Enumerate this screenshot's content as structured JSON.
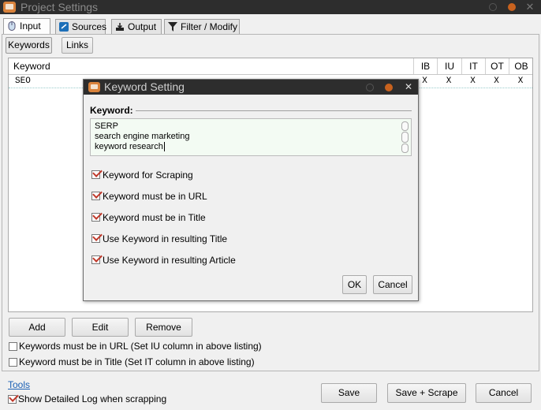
{
  "window": {
    "title": "Project Settings"
  },
  "tabs": [
    {
      "label": "Input"
    },
    {
      "label": "Sources"
    },
    {
      "label": "Output"
    },
    {
      "label": "Filter / Modify"
    }
  ],
  "subtabs": [
    {
      "label": "Keywords"
    },
    {
      "label": "Links"
    }
  ],
  "table": {
    "columns": [
      "Keyword",
      "IB",
      "IU",
      "IT",
      "OT",
      "OB"
    ],
    "rows": [
      {
        "keyword": "SEO",
        "ib": "X",
        "iu": "X",
        "it": "X",
        "ot": "X",
        "ob": "X"
      }
    ]
  },
  "actions": {
    "add": "Add",
    "edit": "Edit",
    "remove": "Remove"
  },
  "options": {
    "in_url": {
      "label": "Keywords must be in URL (Set IU column in above listing)",
      "checked": false
    },
    "in_title": {
      "label": "Keyword must be in Title (Set IT column in above listing)",
      "checked": false
    }
  },
  "footer": {
    "tools_link": "Tools",
    "log_option": {
      "label": "Show Detailed Log when scrapping",
      "checked": true
    },
    "save": "Save",
    "save_scrape": "Save + Scrape",
    "cancel": "Cancel"
  },
  "dialog": {
    "title": "Keyword Setting",
    "keyword_label": "Keyword:",
    "keywords": [
      "SERP",
      "search engine marketing",
      "keyword research"
    ],
    "checkboxes": [
      {
        "label": "Keyword for Scraping",
        "checked": true
      },
      {
        "label": "Keyword must be in URL",
        "checked": true
      },
      {
        "label": "Keyword must be in Title",
        "checked": true
      },
      {
        "label": "Use Keyword in resulting Title",
        "checked": true
      },
      {
        "label": "Use Keyword in resulting Article",
        "checked": true
      }
    ],
    "ok": "OK",
    "cancel": "Cancel"
  },
  "colors": {
    "titlebar": "#2d2d2d",
    "accent_orange": "#d9823b",
    "check_red": "#c0392b",
    "link_blue": "#1a5fb4"
  },
  "icons": [
    "app-icon",
    "mouse-icon",
    "sources-icon",
    "output-icon",
    "filter-icon",
    "minimize-icon",
    "maximize-icon",
    "close-icon"
  ]
}
